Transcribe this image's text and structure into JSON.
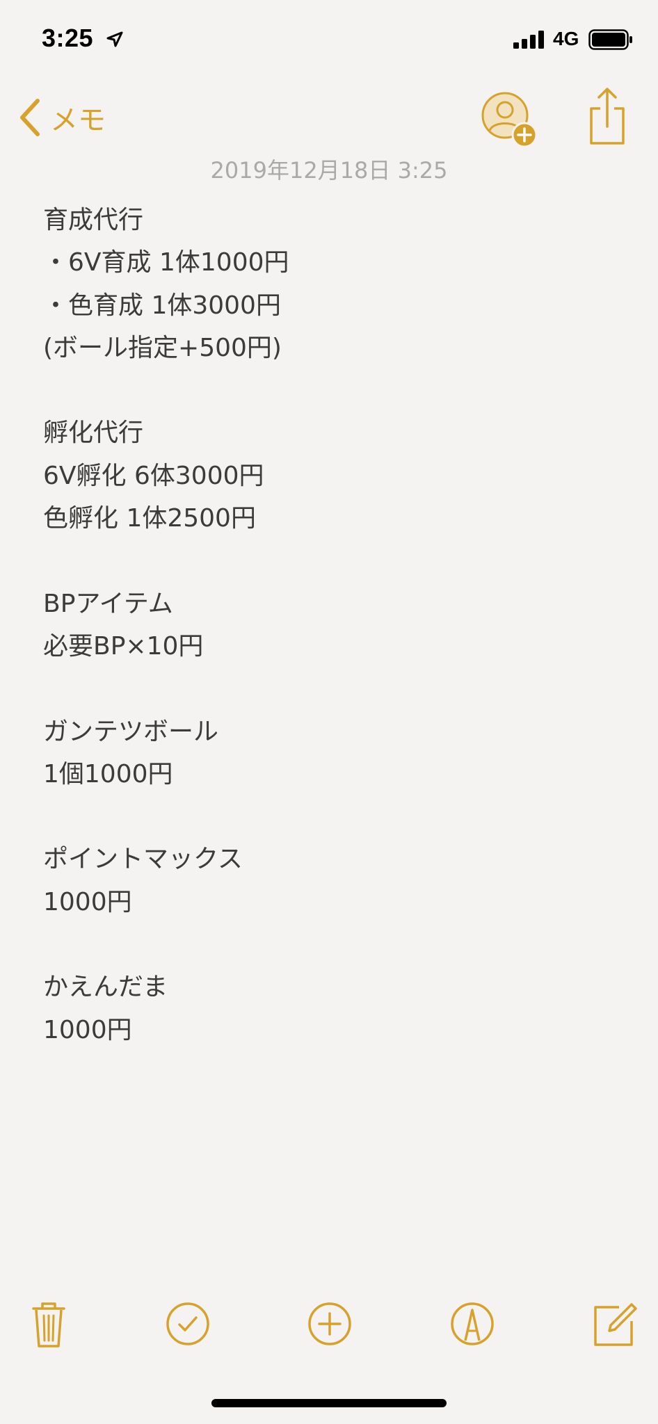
{
  "status_bar": {
    "time": "3:25",
    "network": "4G"
  },
  "nav": {
    "back_label": "メモ"
  },
  "note": {
    "date": "2019年12月18日 3:25",
    "lines": [
      "育成代行",
      "・6V育成 1体1000円",
      "・色育成 1体3000円",
      "(ボール指定+500円)",
      "",
      "孵化代行",
      "6V孵化 6体3000円",
      "色孵化 1体2500円",
      "",
      "BPアイテム",
      "必要BP×10円",
      "",
      "ガンテツボール",
      "1個1000円",
      "",
      "ポイントマックス",
      "1000円",
      "",
      "かえんだま",
      "1000円"
    ]
  },
  "colors": {
    "accent": "#d6a22c",
    "background": "#f4f3f1",
    "text": "#3b3b3b",
    "date_text": "#a9a9a9"
  },
  "icons": {
    "back": "chevron-left-icon",
    "add_person": "add-person-icon",
    "share": "share-icon",
    "trash": "trash-icon",
    "checklist": "checkmark-circle-icon",
    "add": "plus-circle-icon",
    "markup": "markup-pen-icon",
    "compose": "compose-icon"
  }
}
